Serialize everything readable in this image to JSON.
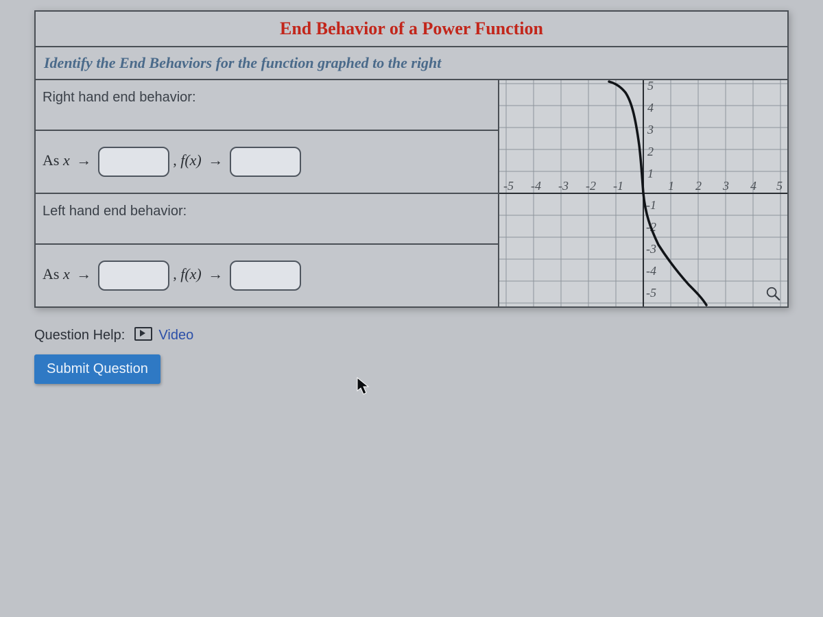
{
  "title": "End Behavior of a Power Function",
  "instruction": "Identify the End Behaviors for the function graphed to the right",
  "rows": {
    "right": {
      "label": "Right hand end behavior:",
      "as": "As",
      "var": "x",
      "arrow": "→",
      "val1": "",
      "comma": ",",
      "fx": "f(x)",
      "val2": ""
    },
    "left": {
      "label": "Left hand end behavior:",
      "as": "As",
      "var": "x",
      "arrow": "→",
      "val1": "",
      "comma": ",",
      "fx": "f(x)",
      "val2": ""
    }
  },
  "help": {
    "label": "Question Help:",
    "video": "Video"
  },
  "submit": "Submit Question",
  "chart_data": {
    "type": "line",
    "title": "",
    "xlabel": "",
    "ylabel": "",
    "xlim": [
      -5,
      5
    ],
    "ylim": [
      -5,
      5
    ],
    "xticks": [
      -5,
      -4,
      -3,
      -2,
      -1,
      1,
      2,
      3,
      4,
      5
    ],
    "yticks": [
      -5,
      -4,
      -3,
      -2,
      -1,
      1,
      2,
      3,
      4,
      5
    ],
    "series": [
      {
        "name": "f(x)",
        "x": [
          -1.2,
          -1.0,
          -0.8,
          -0.6,
          -0.4,
          -0.2,
          0.0,
          0.2,
          0.4,
          0.6,
          0.8,
          1.0,
          1.2,
          1.4,
          1.6,
          1.8,
          2.0,
          2.2
        ],
        "y": [
          5.0,
          5.0,
          4.9,
          4.6,
          3.8,
          2.3,
          0.0,
          -1.1,
          -1.8,
          -2.4,
          -2.9,
          -3.3,
          -3.7,
          -4.1,
          -4.4,
          -4.7,
          -5.0,
          -5.0
        ]
      }
    ]
  }
}
